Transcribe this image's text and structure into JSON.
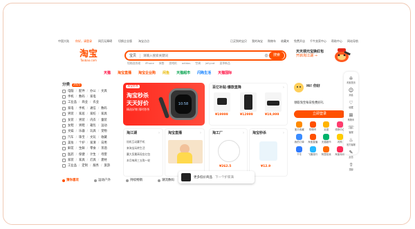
{
  "topbar": {
    "left": [
      "中国大陆",
      "你好，请登录",
      "网页无障碍",
      "切换企业版",
      "淘宝点点"
    ],
    "right": [
      "已买到的宝贝",
      "我的淘宝",
      "购物车",
      "收藏夹",
      "免费开店",
      "千牛卖家中心",
      "帮助中心",
      "网站导航"
    ]
  },
  "header": {
    "logo_cn": "淘宝",
    "logo_en": "Taobao.com",
    "search_scope": "宝贝",
    "search_placeholder": "请输入搜索关键词",
    "search_button": "搜索",
    "hotwords": [
      "短袖连衣裙",
      "iPhone",
      "床垫",
      "游戏机",
      "adidas",
      "空调",
      "jellycat",
      "夏季新品"
    ],
    "promo_line1": "天天领元宝换红包",
    "promo_line2": "开启淘江湖 →"
  },
  "channels": [
    {
      "label": "天猫",
      "color": "#ff0036"
    },
    {
      "label": "淘宝直播",
      "color": "#ff5000"
    },
    {
      "label": "淘宝企业购",
      "color": "#ff5000"
    },
    {
      "label": "闲鱼",
      "color": "#ffd100"
    },
    {
      "label": "天猫超市",
      "color": "#00a04a"
    },
    {
      "label": "闪购生活",
      "color": "#0a7cff"
    },
    {
      "label": "天猫国际",
      "color": "#ff0036"
    }
  ],
  "categories": {
    "title": "分类",
    "badge": "2025",
    "rows": [
      [
        "电脑",
        "配件",
        "办公",
        "文具"
      ],
      [
        "手机",
        "数码",
        "家电"
      ],
      [
        "工业品",
        "商业",
        "农业"
      ],
      [
        "家电",
        "手机",
        "通信",
        "数码"
      ],
      [
        "男装",
        "家居",
        "家纺",
        "家具"
      ],
      [
        "女装",
        "男装",
        "内衣",
        "童装"
      ],
      [
        "女鞋",
        "男鞋",
        "箱包",
        "运动"
      ],
      [
        "文娱",
        "乐器",
        "玩具",
        "宠物"
      ],
      [
        "汽车",
        "珠宝",
        "文玩",
        "收藏"
      ],
      [
        "美妆",
        "个护",
        "家清",
        "日用"
      ],
      [
        "鲜花",
        "生鲜",
        "零食",
        "茶酒"
      ],
      [
        "医药",
        "保健",
        "计生",
        "母婴"
      ],
      [
        "家装",
        "家具",
        "灯具",
        "建材"
      ],
      [
        "工业品",
        "定制",
        "服务",
        "旅游"
      ]
    ]
  },
  "banner": {
    "tag": "淘宝秒杀",
    "line1": "淘宝秒杀",
    "line2": "天天好价",
    "sub": "精选好物 限时秒杀",
    "watch_text": "10:58"
  },
  "sections": {
    "digital": {
      "title": "百亿补贴·爆款直降",
      "prices": [
        "¥19999",
        "¥12999",
        "¥19,999"
      ]
    },
    "rank": {
      "title": "淘江湖",
      "items": [
        "炫机互动赢手机",
        "来淘宝玩转生活",
        "赢大奖最高现金红包",
        "本月每周三五购一轮"
      ]
    },
    "live": {
      "title": "淘宝直播"
    },
    "factory": {
      "title": "淘工厂",
      "price": "¥262.5"
    },
    "newarrive": {
      "title": "淘宝秒杀",
      "price": "¥12.9"
    }
  },
  "user": {
    "greeting": "Hi! 你好",
    "sub1": "领取淘宝每日免费好礼",
    "login": "立即登录",
    "apps": [
      "宝贝收藏",
      "购物车",
      "足迹",
      "领券中心",
      "我的订单",
      "淘宝直播",
      "天猫超市",
      "闪购",
      "千牛",
      "飞猪旅行",
      "阿里拍卖",
      "淘宝特价"
    ]
  },
  "sidebar": [
    {
      "icon": "⌂",
      "label": "淘宝首页"
    },
    {
      "icon": "☺",
      "label": "消息"
    },
    {
      "icon": "♡",
      "label": "收藏"
    },
    {
      "icon": "⊞",
      "label": "购物车"
    },
    {
      "icon": "☏",
      "label": "客服"
    },
    {
      "icon": "♨",
      "label": "官方客服"
    },
    {
      "icon": "✎",
      "label": "反馈"
    },
    {
      "icon": "⇧",
      "label": "顶部"
    }
  ],
  "bottom": {
    "items": [
      {
        "label": "猜你喜欢",
        "color": "#ff5000"
      },
      {
        "label": "运动户外",
        "color": "#555"
      },
      {
        "label": "持续畅销",
        "color": "#555"
      },
      {
        "label": "潮流数码",
        "color": "#555"
      }
    ],
    "tooltip": "更多低价商品",
    "tooltip2": "下一个护家满"
  }
}
